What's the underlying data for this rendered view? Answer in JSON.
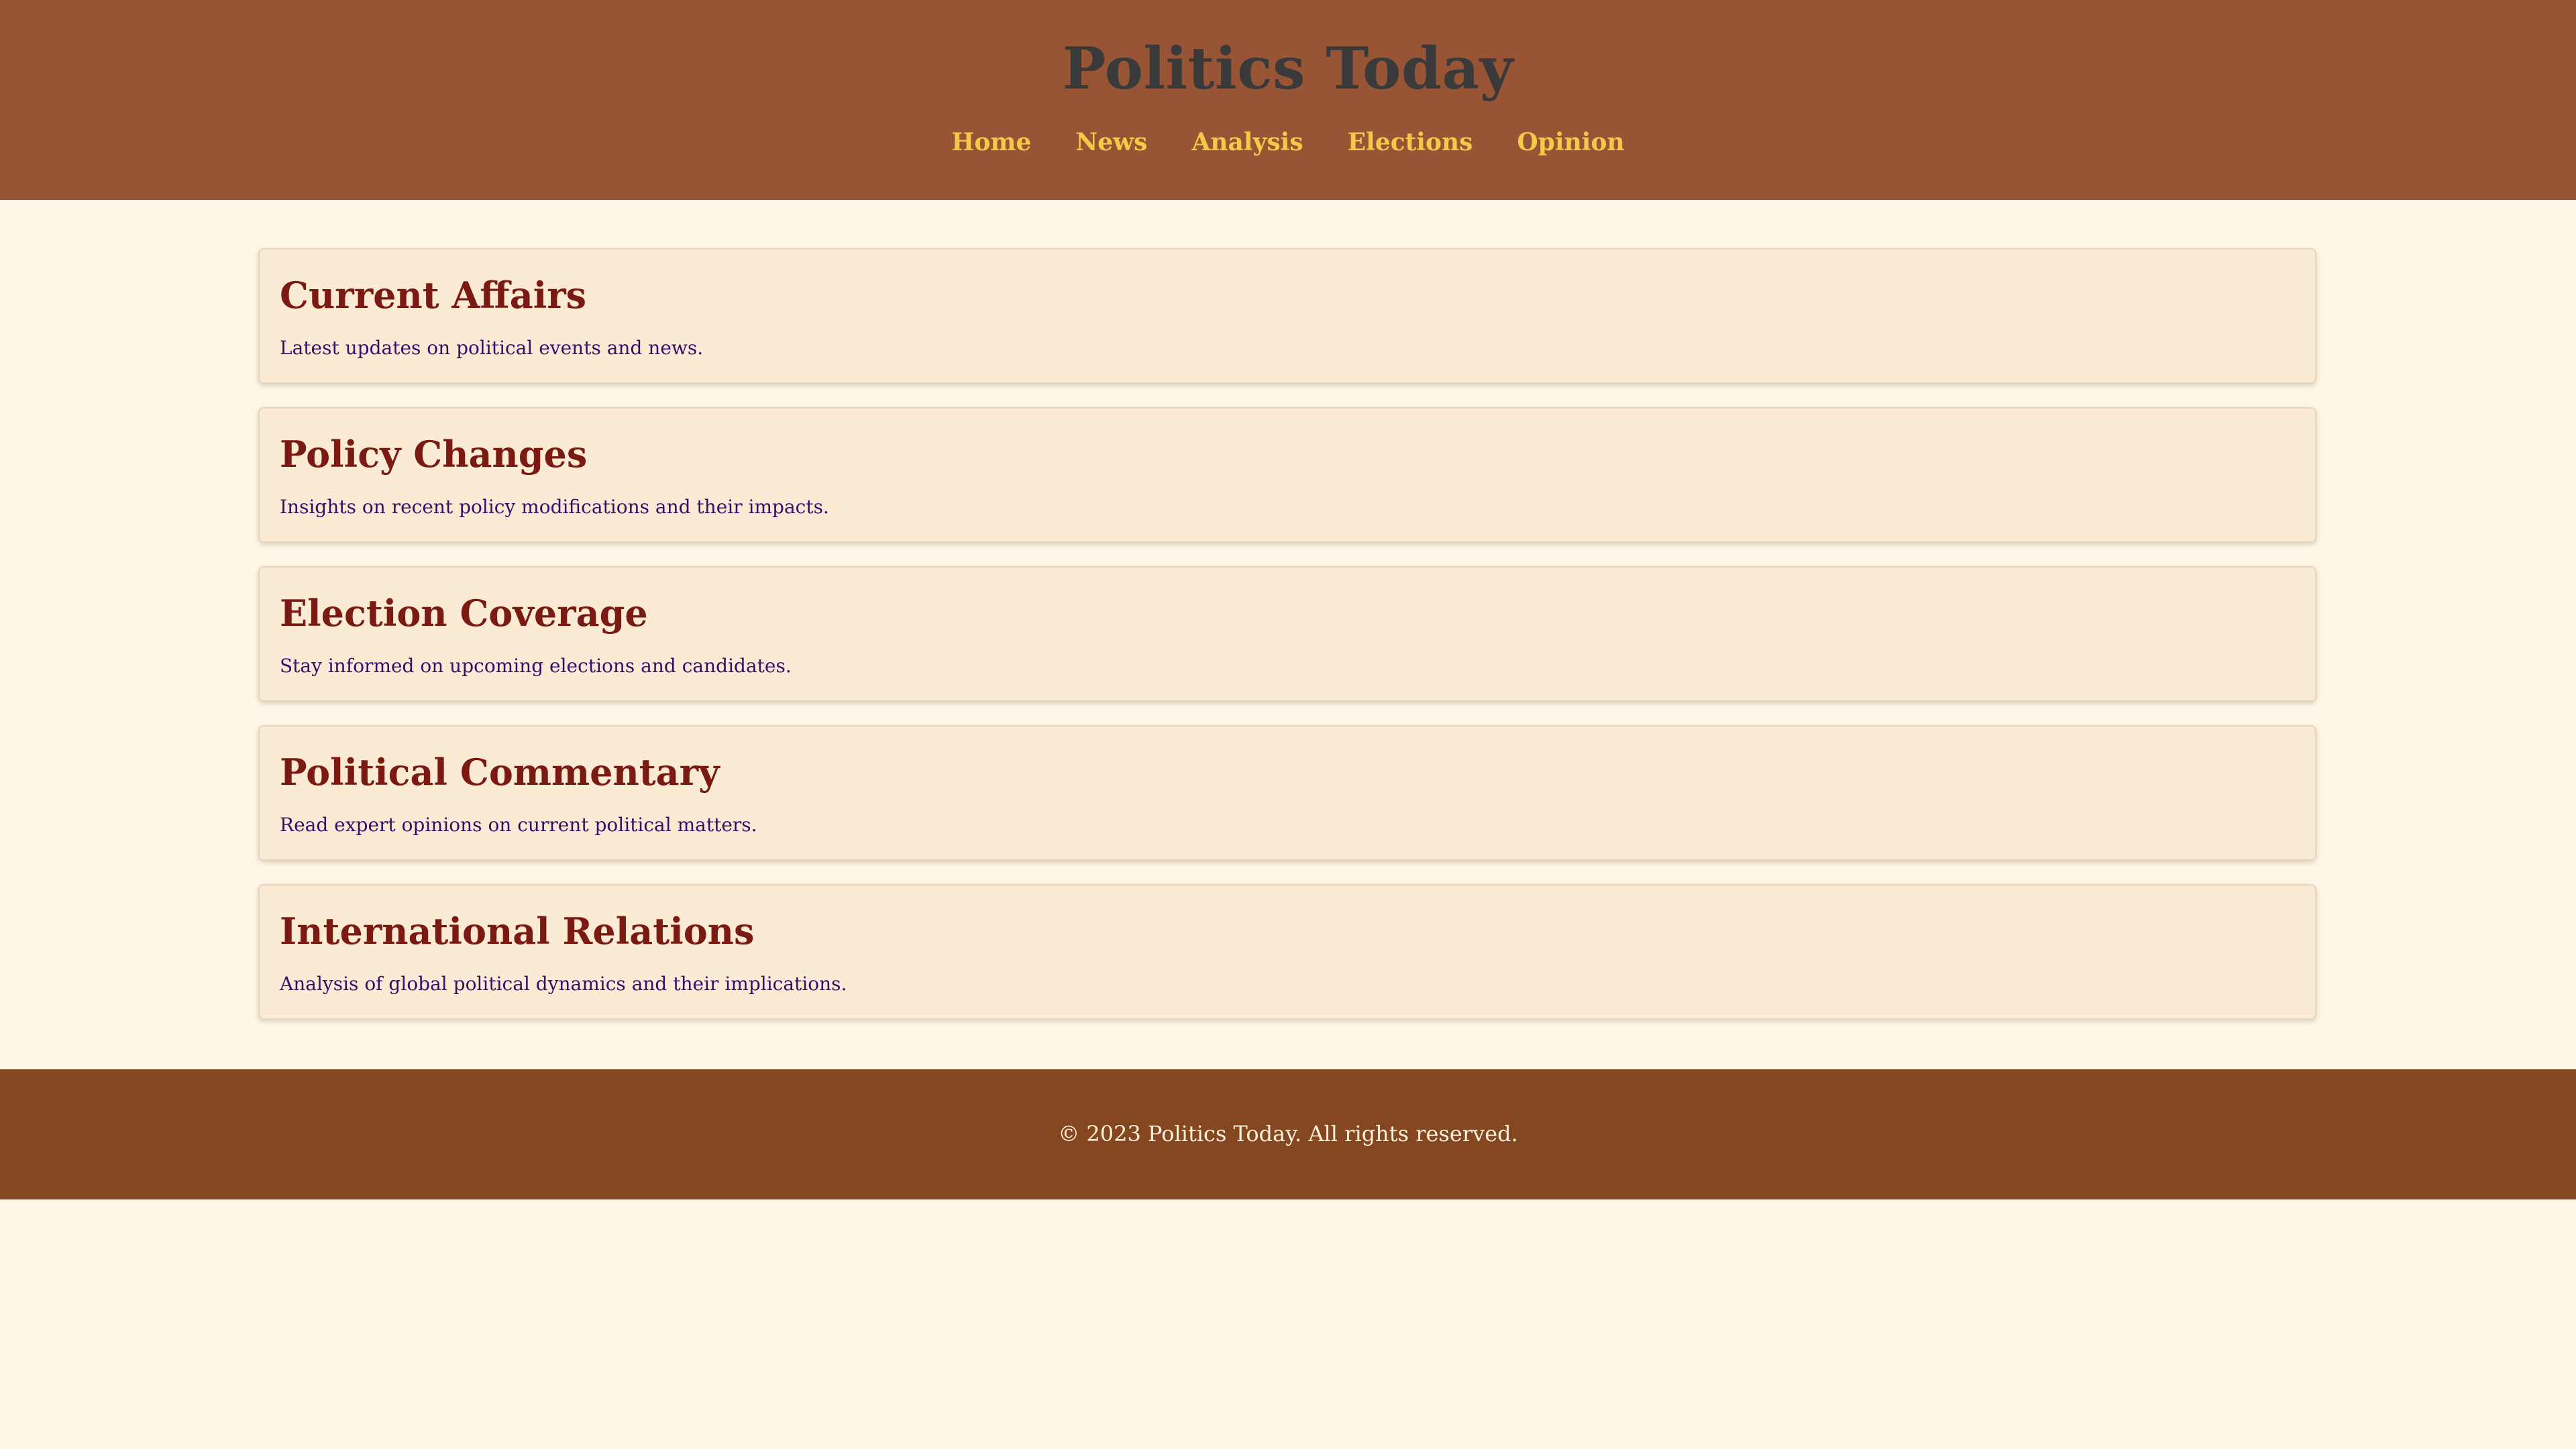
{
  "site": {
    "title": "Politics Today"
  },
  "nav": {
    "items": [
      {
        "label": "Home"
      },
      {
        "label": "News"
      },
      {
        "label": "Analysis"
      },
      {
        "label": "Elections"
      },
      {
        "label": "Opinion"
      }
    ]
  },
  "sections": [
    {
      "title": "Current Affairs",
      "description": "Latest updates on political events and news."
    },
    {
      "title": "Policy Changes",
      "description": "Insights on recent policy modifications and their impacts."
    },
    {
      "title": "Election Coverage",
      "description": "Stay informed on upcoming elections and candidates."
    },
    {
      "title": "Political Commentary",
      "description": "Read expert opinions on current political matters."
    },
    {
      "title": "International Relations",
      "description": "Analysis of global political dynamics and their implications."
    }
  ],
  "footer": {
    "text": "© 2023 Politics Today. All rights reserved."
  },
  "colors": {
    "header_bg": "#985536",
    "nav_link": "#F4C94A",
    "page_bg": "#FFF7E6",
    "card_bg": "#FCEBD4",
    "card_title": "#7A1A12",
    "card_text": "#3A0B6B",
    "footer_bg": "#844720"
  }
}
